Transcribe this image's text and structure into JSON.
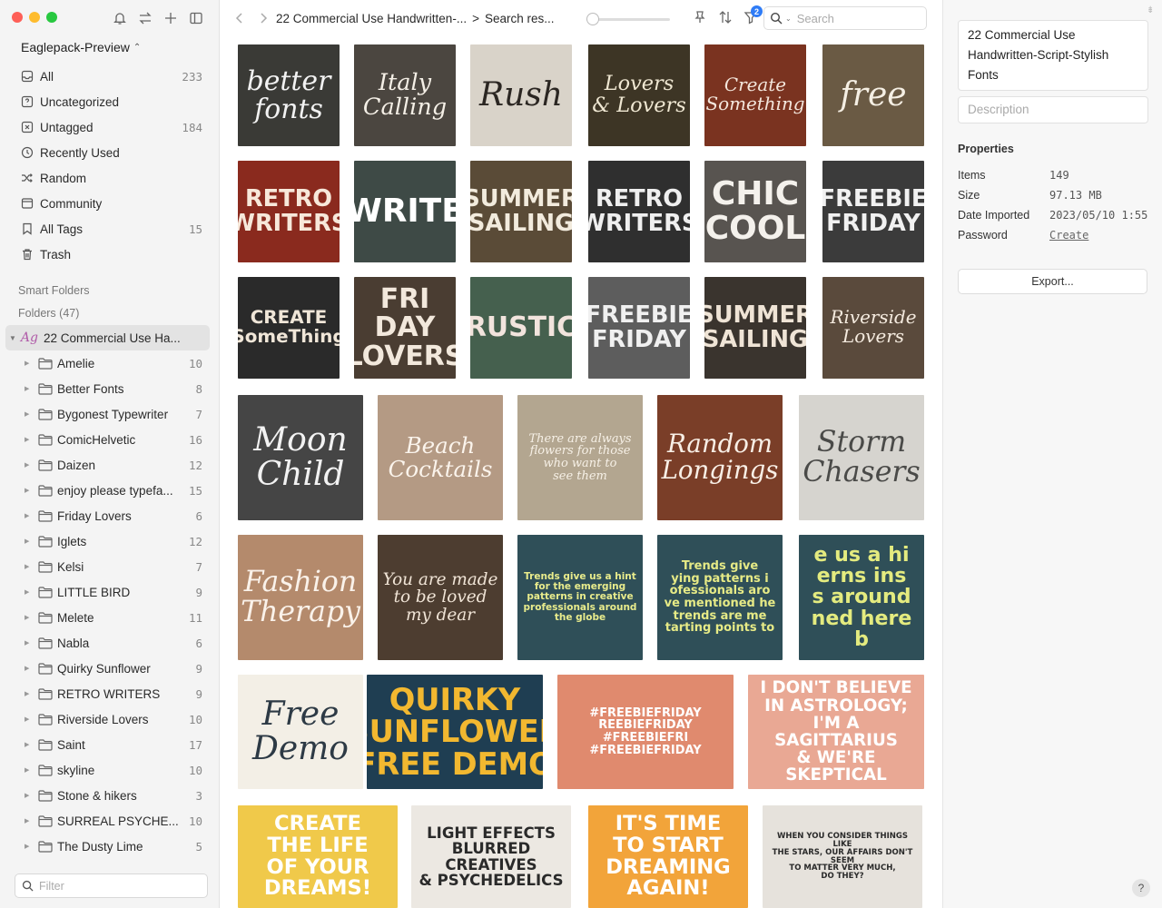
{
  "sidebar": {
    "library": "Eaglepack-Preview",
    "nav": [
      {
        "label": "All",
        "count": "233",
        "icon": "inbox-icon"
      },
      {
        "label": "Uncategorized",
        "count": "",
        "icon": "question-box-icon"
      },
      {
        "label": "Untagged",
        "count": "184",
        "icon": "untagged-icon"
      },
      {
        "label": "Recently Used",
        "count": "",
        "icon": "clock-icon"
      },
      {
        "label": "Random",
        "count": "",
        "icon": "shuffle-icon"
      },
      {
        "label": "Community",
        "count": "",
        "icon": "community-icon"
      },
      {
        "label": "All Tags",
        "count": "15",
        "icon": "bookmark-icon"
      },
      {
        "label": "Trash",
        "count": "",
        "icon": "trash-icon"
      }
    ],
    "smart_folders": "Smart Folders",
    "folders_header": "Folders (47)",
    "root_folder": "22 Commercial Use Ha...",
    "root_icon_text": "Ag",
    "folders": [
      {
        "label": "Amelie",
        "count": "10"
      },
      {
        "label": "Better Fonts",
        "count": "8"
      },
      {
        "label": "Bygonest Typewriter",
        "count": "7"
      },
      {
        "label": "ComicHelvetic",
        "count": "16"
      },
      {
        "label": "Daizen",
        "count": "12"
      },
      {
        "label": "enjoy please typefa...",
        "count": "15"
      },
      {
        "label": "Friday Lovers",
        "count": "6"
      },
      {
        "label": "Iglets",
        "count": "12"
      },
      {
        "label": "Kelsi",
        "count": "7"
      },
      {
        "label": "LITTLE BIRD",
        "count": "9"
      },
      {
        "label": "Melete",
        "count": "11"
      },
      {
        "label": "Nabla",
        "count": "6"
      },
      {
        "label": "Quirky Sunflower",
        "count": "9"
      },
      {
        "label": "RETRO WRITERS",
        "count": "9"
      },
      {
        "label": "Riverside Lovers",
        "count": "10"
      },
      {
        "label": "Saint",
        "count": "17"
      },
      {
        "label": "skyline",
        "count": "10"
      },
      {
        "label": "Stone & hikers",
        "count": "3"
      },
      {
        "label": "SURREAL PSYCHE...",
        "count": "10"
      },
      {
        "label": "The Dusty Lime",
        "count": "5"
      }
    ],
    "filter_placeholder": "Filter"
  },
  "toolbar": {
    "breadcrumb_1": "22 Commercial Use Handwritten-...",
    "breadcrumb_sep": ">",
    "breadcrumb_2": "Search res...",
    "zoom_fraction": 0.0,
    "filter_badge": "2",
    "search_placeholder": "Search"
  },
  "grid": [
    {
      "text": "better\nfonts",
      "bg": "#3a3a36",
      "fg": "#f2f2f2",
      "font": "serif"
    },
    {
      "text": "Italy\nCalling",
      "bg": "#4b4640",
      "fg": "#f4efe6",
      "font": "serif"
    },
    {
      "text": "Rush",
      "bg": "#d9d3c9",
      "fg": "#2b2622",
      "font": "serif"
    },
    {
      "text": "Lovers\n& Lovers",
      "bg": "#3d3525",
      "fg": "#efe7d2",
      "font": "serif"
    },
    {
      "text": "Create\nSomething",
      "bg": "#7a3320",
      "fg": "#f3e6dc",
      "font": "serif"
    },
    {
      "text": "free",
      "bg": "#6a5a44",
      "fg": "#f5efe4",
      "font": "serif"
    },
    {
      "text": "RETRO\nWRITERS",
      "bg": "#8a2a1e",
      "fg": "#f7e8da",
      "font": "sans"
    },
    {
      "text": "WRITE",
      "bg": "#3e4a46",
      "fg": "#ffffff",
      "font": "sans"
    },
    {
      "text": "SUMMER\nSAILING",
      "bg": "#5a4b37",
      "fg": "#f2ebdd",
      "font": "sans"
    },
    {
      "text": "RETRO\nWRITERS",
      "bg": "#2f2f2f",
      "fg": "#efefef",
      "font": "sans"
    },
    {
      "text": "CHIC\nCOOL",
      "bg": "#585450",
      "fg": "#f4f1ec",
      "font": "sans"
    },
    {
      "text": "FREEBIE\nFRIDAY",
      "bg": "#3b3b3b",
      "fg": "#f1f1f1",
      "font": "sans"
    },
    {
      "text": "CREATE\nSomeThing",
      "bg": "#2a2a2a",
      "fg": "#f0e6d8",
      "font": "sans"
    },
    {
      "text": "FRI\nDAY\nLOVERS",
      "bg": "#4a3d32",
      "fg": "#f2e8dc",
      "font": "sans"
    },
    {
      "text": "RUSTIC",
      "bg": "#45604e",
      "fg": "#f2e4dd",
      "font": "sans"
    },
    {
      "text": "FREEBIE\nFRIDAY",
      "bg": "#5d5d5d",
      "fg": "#f0f0f0",
      "font": "sans"
    },
    {
      "text": "SUMMER\nSAILING",
      "bg": "#3a342e",
      "fg": "#efe4d6",
      "font": "sans"
    },
    {
      "text": "Riverside\nLovers",
      "bg": "#5a4a3c",
      "fg": "#f5ebdf",
      "font": "serif"
    },
    {
      "text": "Moon\nChild",
      "bg": "#454545",
      "fg": "#f2f2f2",
      "font": "serif"
    },
    {
      "text": "Beach\nCocktails",
      "bg": "#b49a84",
      "fg": "#fbf4ec",
      "font": "serif"
    },
    {
      "text": "There are always\nflowers for those\nwho want to\nsee them",
      "bg": "#b3a690",
      "fg": "#f6f0e6",
      "font": "serif"
    },
    {
      "text": "Random\nLongings",
      "bg": "#7a3e28",
      "fg": "#f8efe6",
      "font": "serif"
    },
    {
      "text": "Storm\nChasers",
      "bg": "#d6d4cf",
      "fg": "#4a4a48",
      "font": "serif"
    },
    {
      "text": "Fashion\nTherapy",
      "bg": "#b48a6c",
      "fg": "#faf2ea",
      "font": "serif"
    },
    {
      "text": "You are made\nto be loved\nmy dear",
      "bg": "#4d3d30",
      "fg": "#f0e4d6",
      "font": "serif"
    },
    {
      "text": "Trends give us a hint\nfor the emerging\npatterns in creative\nprofessionals around\nthe globe",
      "bg": "#2f4f58",
      "fg": "#e9ec8c",
      "font": "sans"
    },
    {
      "text": "Trends give\nying patterns i\nofessionals aro\nve mentioned he\ntrends are me\ntarting points to",
      "bg": "#2f4f58",
      "fg": "#e6ea86",
      "font": "sans"
    },
    {
      "text": "e us a hi\nerns ins\ns around\nned here b",
      "bg": "#2f4f58",
      "fg": "#e4eb7f",
      "font": "sans"
    },
    {
      "text": "Free\nDemo",
      "bg": "#f3efe6",
      "fg": "#2d3a45",
      "font": "serif"
    },
    {
      "text": "QUIRKY\nSUNFLOWER\nFREE DEMO",
      "bg": "#1f3e52",
      "fg": "#f2b830",
      "font": "sans"
    },
    {
      "text": "#FREEBIEFRIDAY\nREEBIEFRIDAY #FREEBIEFRI\n#FREEBIEFRIDAY",
      "bg": "#e08a6e",
      "fg": "#ffffff",
      "font": "sans"
    },
    {
      "text": "I DON'T BELIEVE\nIN ASTROLOGY;\nI'M A SAGITTARIUS\n& WE'RE SKEPTICAL",
      "bg": "#e9a894",
      "fg": "#ffffff",
      "font": "sans"
    },
    {
      "text": "CREATE\nTHE LIFE\nOF YOUR\nDREAMS!",
      "bg": "#f0c94a",
      "fg": "#ffffff",
      "font": "sans"
    },
    {
      "text": "LIGHT EFFECTS\nBLURRED CREATIVES\n& PSYCHEDELICS",
      "bg": "#ece8e2",
      "fg": "#2a2a2a",
      "font": "sans"
    },
    {
      "text": "IT'S TIME\nTO START\nDREAMING\nAGAIN!",
      "bg": "#f2a43a",
      "fg": "#ffffff",
      "font": "sans"
    },
    {
      "text": "WHEN YOU CONSIDER THINGS LIKE\nTHE STARS, OUR AFFAIRS DON'T SEEM\nTO MATTER VERY MUCH,\nDO THEY?",
      "bg": "#e6e2dc",
      "fg": "#2a2a2a",
      "font": "sans"
    }
  ],
  "inspector": {
    "title": "22 Commercial Use Handwritten-Script-Stylish Fonts",
    "description_placeholder": "Description",
    "properties_header": "Properties",
    "props": [
      {
        "k": "Items",
        "v": "149"
      },
      {
        "k": "Size",
        "v": "97.13 MB"
      },
      {
        "k": "Date Imported",
        "v": "2023/05/10 1:55"
      },
      {
        "k": "Password",
        "v": "Create"
      }
    ],
    "export_label": "Export...",
    "help_label": "?"
  },
  "colors": {
    "accent": "#2f7cf6",
    "selected_row": "#e3e3e3"
  }
}
